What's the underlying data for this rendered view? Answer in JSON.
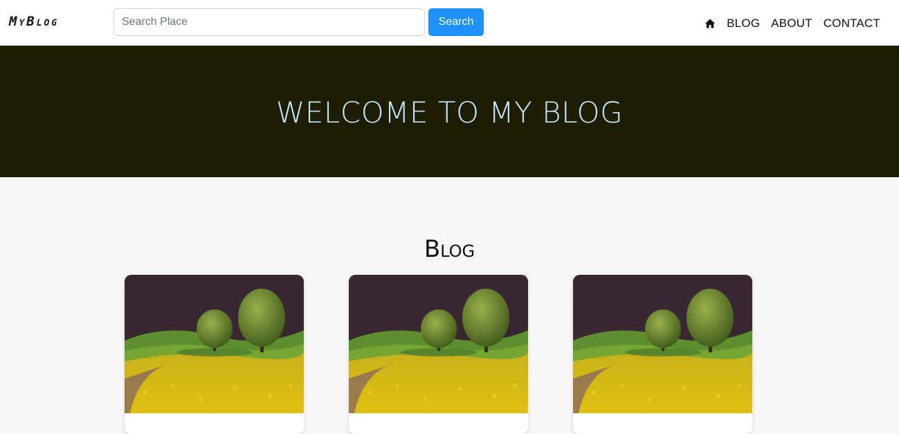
{
  "navbar": {
    "brand": "MyBlog",
    "search": {
      "placeholder": "Search Place",
      "value": "",
      "button_label": "Search"
    },
    "links": [
      {
        "icon": "home-icon"
      },
      {
        "label": "BLOG"
      },
      {
        "label": "ABOUT"
      },
      {
        "label": "CONTACT"
      }
    ]
  },
  "hero": {
    "title": "WELCOME TO MY BLOG"
  },
  "blog": {
    "title": "Blog",
    "cards": [
      {
        "image": "landscape-field-trees"
      },
      {
        "image": "landscape-field-trees"
      },
      {
        "image": "landscape-field-trees"
      }
    ]
  },
  "colors": {
    "primary": "#1e90ff",
    "hero_bg": "#1e1e02",
    "hero_text": "#c9e6ff",
    "page_bg": "#f6f6f6"
  }
}
